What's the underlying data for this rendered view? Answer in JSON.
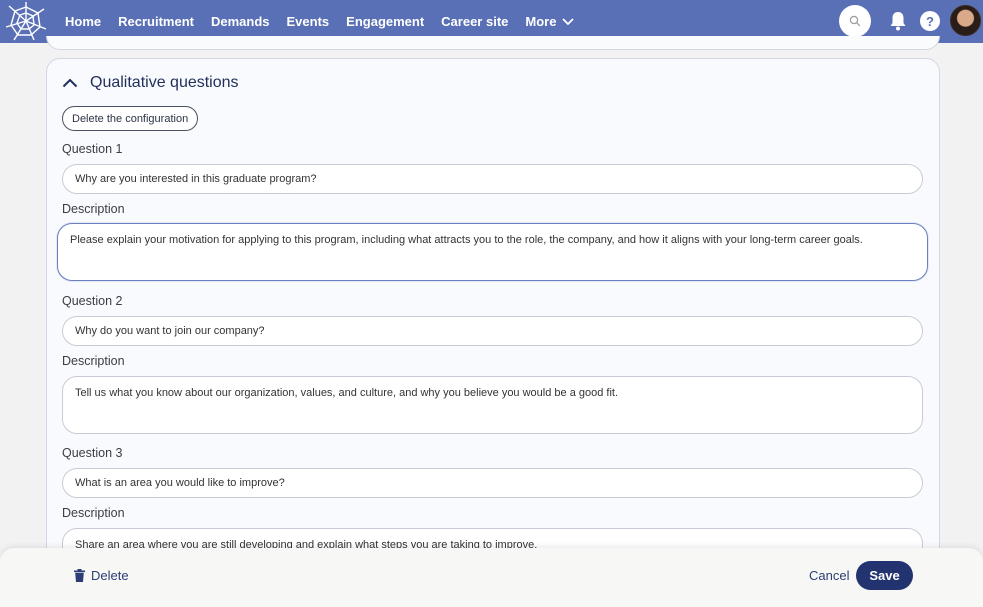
{
  "nav": {
    "items": [
      {
        "label": "Home"
      },
      {
        "label": "Recruitment"
      },
      {
        "label": "Demands"
      },
      {
        "label": "Events"
      },
      {
        "label": "Engagement"
      },
      {
        "label": "Career site"
      },
      {
        "label": "More"
      }
    ],
    "help_label": "?"
  },
  "section": {
    "title": "Qualitative questions",
    "delete_config_label": "Delete the configuration",
    "questions": [
      {
        "question_label": "Question 1",
        "question_value": "Why are you interested in this graduate program?",
        "description_label": "Description",
        "description_value": "Please explain your motivation for applying to this program, including what attracts you to the role, the company, and how it aligns with your long-term career goals."
      },
      {
        "question_label": "Question 2",
        "question_value": "Why do you want to join our company?",
        "description_label": "Description",
        "description_value": "Tell us what you know about our organization, values, and culture, and why you believe you would be a good fit."
      },
      {
        "question_label": "Question 3",
        "question_value": "What is an area you would like to improve?",
        "description_label": "Description",
        "description_value": "Share an area where you are still developing and explain what steps you are taking to improve."
      }
    ]
  },
  "footer": {
    "delete_label": "Delete",
    "cancel_label": "Cancel",
    "save_label": "Save"
  },
  "colors": {
    "nav_bg": "#5a70b6",
    "primary": "#22336f",
    "focus_border": "#6d7fbd"
  }
}
